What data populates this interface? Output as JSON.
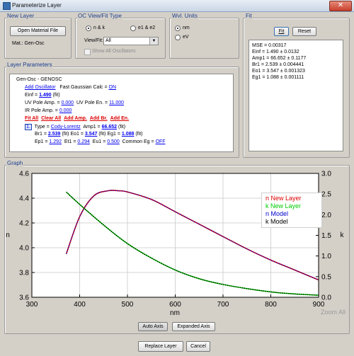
{
  "window": {
    "title": "Parameterize Layer",
    "close_glyph": "✕"
  },
  "new_layer": {
    "title": "New Layer",
    "open_button": "Open Material File",
    "material": "Mat.: Gen-Osc"
  },
  "oc_view": {
    "title": "OC View/Fit Type",
    "opt_nk": "n & k",
    "opt_e1e2": "e1 & e2",
    "viewfit_label": "View/Fit:",
    "viewfit_value": "All",
    "show_all": "Show All Oscillators"
  },
  "units": {
    "title": "Wvl. Units",
    "nm": "nm",
    "ev": "eV"
  },
  "fit": {
    "title": "Fit",
    "fit_button": "Fit",
    "reset_button": "Reset",
    "results": [
      "MSE = 0.00317",
      "Einf = 1.490 ± 0.0132",
      "Amp1 = 66.652 ± 0.1177",
      "Br1 = 2.539 ± 0.004441",
      "Eo1 = 3.547 ± 0.001323",
      "Eg1 = 1.088 ± 0.001111"
    ]
  },
  "layer": {
    "title": "Layer Parameters",
    "name": "Gen-Osc - GENOSC",
    "add_osc": "Add Oscillator",
    "fast_calc_label": "Fast Gaussian Calc =",
    "fast_calc_value": "ON",
    "einf_label": "Einf =",
    "einf_value": "1.490",
    "fit_tag": "(fit)",
    "uv_amp_label": "UV Pole Amp. =",
    "uv_amp_value": "0.000",
    "uv_en_label": "UV Pole En. =",
    "uv_en_value": "11.000",
    "ir_amp_label": "IR Pole Amp. =",
    "ir_amp_value": "0.000",
    "actions": [
      "Fit All",
      "Clear All",
      "Add Amp.",
      "Add Br.",
      "Add En."
    ],
    "osc_index": "1.",
    "type_label": "Type =",
    "type_value": "Cody-Lorentz",
    "amp1_label": "Amp1 =",
    "amp1_value": "66.652",
    "br1_label": "Br1 =",
    "br1_value": "2.539",
    "eo1_label": "Eo1 =",
    "eo1_value": "3.547",
    "eg1_label": "Eg1 =",
    "eg1_value": "1.088",
    "ep1_label": "Ep1 =",
    "ep1_value": "1.292",
    "et1_label": "Et1 =",
    "et1_value": "0.294",
    "eu1_label": "Eu1 =",
    "eu1_value": "0.500",
    "common_eg_label": "Common Eg =",
    "common_eg_value": "OFF"
  },
  "graph": {
    "title": "Graph",
    "zoom_label": "Zoom All",
    "auto_axis": "Auto Axis",
    "expanded_axis": "Expanded Axis"
  },
  "footer": {
    "replace": "Replace Layer",
    "cancel": "Cancel"
  },
  "colors": {
    "n_new": "#dd0000",
    "k_new": "#00cc00",
    "model": "#000000",
    "accent": "#1d3f8f"
  },
  "chart_data": {
    "type": "line",
    "xlabel": "nm",
    "ylabel": "n",
    "y2label": "k",
    "xlim": [
      300,
      900
    ],
    "ylim": [
      3.6,
      4.6
    ],
    "y2lim": [
      0.0,
      3.0
    ],
    "xticks": [
      300,
      400,
      500,
      600,
      700,
      800,
      900
    ],
    "yticks": [
      3.6,
      3.8,
      4.0,
      4.2,
      4.4,
      4.6
    ],
    "y2ticks": [
      0.0,
      0.5,
      1.0,
      1.5,
      2.0,
      2.5,
      3.0
    ],
    "grid": true,
    "legend_position": "right",
    "legend": [
      "n New Layer",
      "k New Layer",
      "n Model",
      "k Model"
    ],
    "series": [
      {
        "name": "n New Layer",
        "axis": "left",
        "color": "#dd0000",
        "x": [
          372,
          400,
          430,
          460,
          480,
          500,
          550,
          600,
          650,
          700,
          750,
          800,
          850,
          900
        ],
        "y": [
          3.95,
          4.25,
          4.42,
          4.46,
          4.46,
          4.45,
          4.39,
          4.29,
          4.19,
          4.09,
          3.99,
          3.9,
          3.82,
          3.74
        ]
      },
      {
        "name": "k New Layer",
        "axis": "right",
        "color": "#00cc00",
        "x": [
          372,
          400,
          450,
          500,
          550,
          600,
          650,
          700,
          750,
          800,
          850,
          900
        ],
        "y": [
          2.55,
          2.25,
          1.75,
          1.3,
          0.95,
          0.66,
          0.45,
          0.31,
          0.21,
          0.13,
          0.08,
          0.05
        ]
      },
      {
        "name": "n Model",
        "axis": "left",
        "color": "#0000cc",
        "x": [
          372,
          400,
          430,
          460,
          480,
          500,
          550,
          600,
          650,
          700,
          750,
          800,
          850,
          900
        ],
        "y": [
          3.95,
          4.25,
          4.42,
          4.46,
          4.46,
          4.45,
          4.39,
          4.29,
          4.19,
          4.09,
          3.99,
          3.9,
          3.82,
          3.74
        ]
      },
      {
        "name": "k Model",
        "axis": "right",
        "color": "#000000",
        "x": [
          372,
          400,
          450,
          500,
          550,
          600,
          650,
          700,
          750,
          800,
          850,
          900
        ],
        "y": [
          2.55,
          2.25,
          1.75,
          1.3,
          0.95,
          0.66,
          0.45,
          0.31,
          0.21,
          0.13,
          0.08,
          0.05
        ]
      }
    ]
  }
}
